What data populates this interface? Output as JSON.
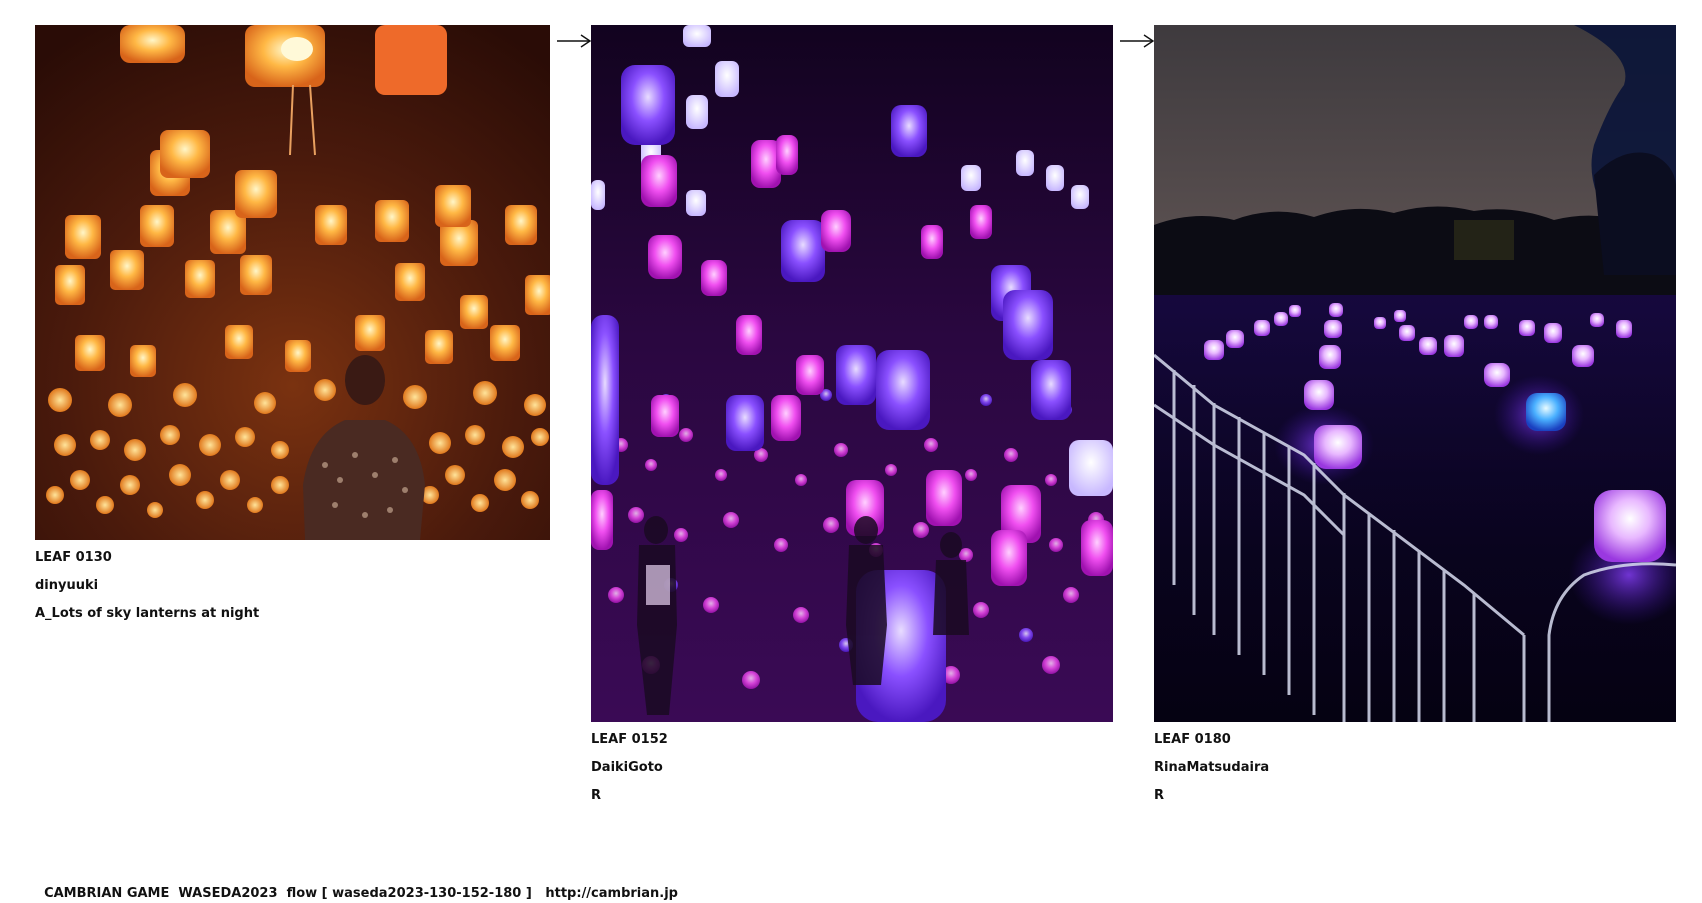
{
  "leaves": [
    {
      "leaf_label": "LEAF 0130",
      "author": "dinyuuki",
      "title": "A_Lots of sky lanterns at night"
    },
    {
      "leaf_label": "LEAF 0152",
      "author": "DaikiGoto",
      "title": "R"
    },
    {
      "leaf_label": "LEAF 0180",
      "author": "RinaMatsudaira",
      "title": "R"
    }
  ],
  "footer": {
    "text": "CAMBRIAN GAME  WASEDA2023  flow [ waseda2023-130-152-180 ]   ",
    "link": "http://cambrian.jp"
  },
  "icons": {
    "flow_arrow": "right-arrow-icon"
  },
  "colors": {
    "lantern_orange": "#f2a23a",
    "lantern_magenta": "#e040ff",
    "lantern_violet": "#7a3cff",
    "night_background": "#1a0530"
  }
}
